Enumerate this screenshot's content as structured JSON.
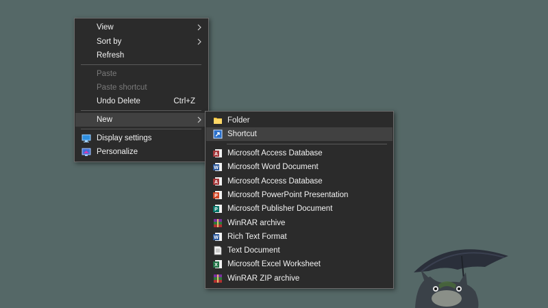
{
  "context_menu": {
    "items": [
      {
        "label": "View"
      },
      {
        "label": "Sort by"
      },
      {
        "label": "Refresh"
      },
      {
        "label": "Paste"
      },
      {
        "label": "Paste shortcut"
      },
      {
        "label": "Undo Delete",
        "shortcut": "Ctrl+Z"
      },
      {
        "label": "New"
      },
      {
        "label": "Display settings"
      },
      {
        "label": "Personalize"
      }
    ]
  },
  "new_submenu": {
    "items": [
      {
        "label": "Folder"
      },
      {
        "label": "Shortcut"
      },
      {
        "label": "Microsoft Access Database"
      },
      {
        "label": "Microsoft Word Document"
      },
      {
        "label": "Microsoft Access Database"
      },
      {
        "label": "Microsoft PowerPoint Presentation"
      },
      {
        "label": "Microsoft Publisher Document"
      },
      {
        "label": "WinRAR archive"
      },
      {
        "label": "Rich Text Format"
      },
      {
        "label": "Text Document"
      },
      {
        "label": "Microsoft Excel Worksheet"
      },
      {
        "label": "WinRAR ZIP archive"
      }
    ]
  },
  "colors": {
    "desktop_background": "#556867",
    "menu_background": "#2b2b2b",
    "highlight": "#414141",
    "text": "#f2f2f2",
    "disabled_text": "#7a7a7a"
  }
}
